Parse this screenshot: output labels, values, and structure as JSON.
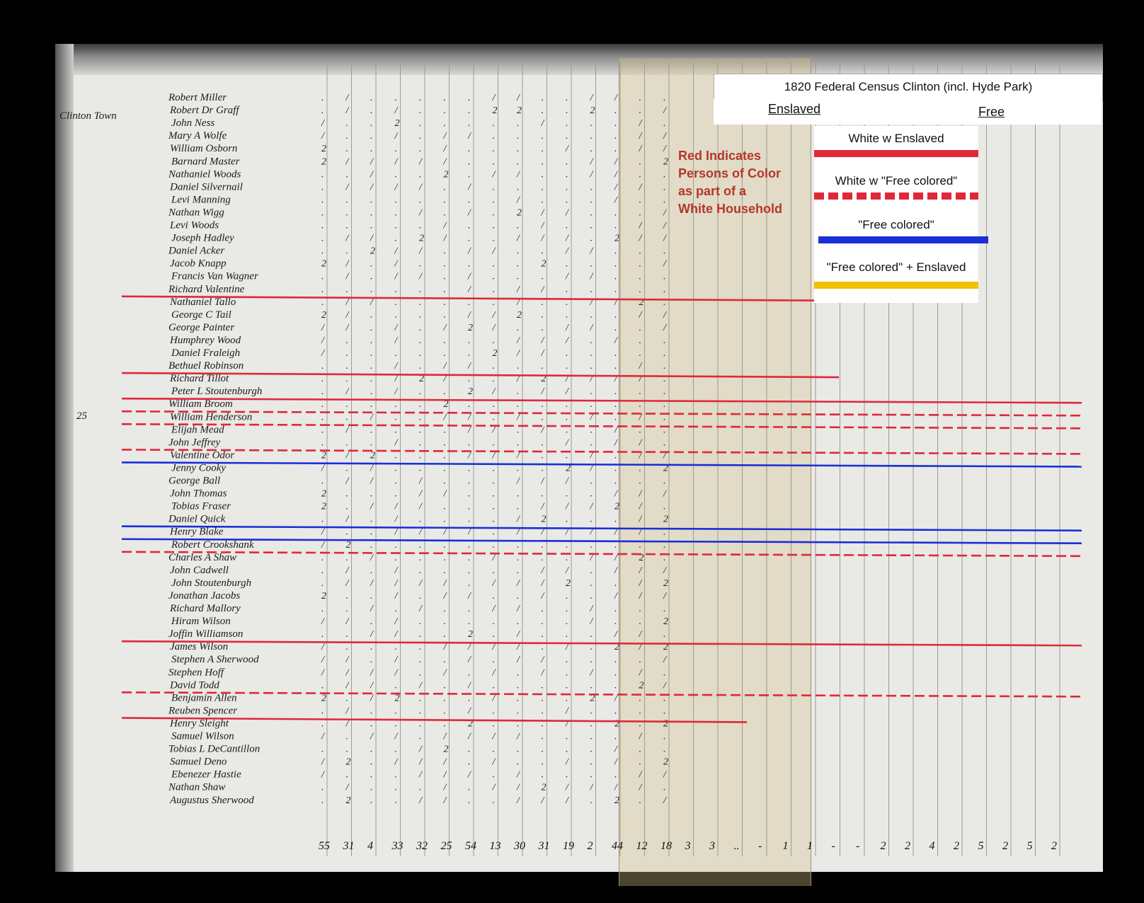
{
  "header": {
    "title": "1820 Federal Census Clinton (incl. Hyde Park)",
    "enslaved_label": "Enslaved",
    "free_label": "Free"
  },
  "red_note": "Red Indicates\nPersons of Color\nas part of a\nWhite Household",
  "legend": {
    "items": [
      {
        "label": "White w Enslaved",
        "color": "#e0283a",
        "style": "solid"
      },
      {
        "label": "White w \"Free colored\"",
        "color": "#e0283a",
        "style": "dashed"
      },
      {
        "label": "\"Free colored\"",
        "color": "#1a2ed6",
        "style": "solid"
      },
      {
        "label": "\"Free colored\" + Enslaved",
        "color": "#f5c000",
        "style": "solid"
      }
    ]
  },
  "page_number": "25",
  "town_label": "Clinton Town",
  "names": [
    "Robert Miller",
    "Robert Dr Graff",
    "John Ness",
    "Mary A Wolfe",
    "William Osborn",
    "Barnard Master",
    "Nathaniel Woods",
    "Daniel Silvernail",
    "Levi Manning",
    "Nathan Wigg",
    "Levi Woods",
    "Joseph Hadley",
    "Daniel Acker",
    "Jacob Knapp",
    "Francis Van Wagner",
    "Richard Valentine",
    "Nathaniel Tallo",
    "George C Tail",
    "George Painter",
    "Humphrey Wood",
    "Daniel Fraleigh",
    "Bethuel Robinson",
    "Richard Tillot",
    "Peter L Stoutenburgh",
    "William Broom",
    "William Henderson",
    "Elijah Mead",
    "John Jeffrey",
    "Valentine Odor",
    "Jenny Cooky",
    "George Ball",
    "John Thomas",
    "Tobias Fraser",
    "Daniel Quick",
    "Henry Blake",
    "Robert Crookshank",
    "Charles A Shaw",
    "John Cadwell",
    "John Stoutenburgh",
    "Jonathan Jacobs",
    "Richard Mallory",
    "Hiram Wilson",
    "Joffin Williamson",
    "James Wilson",
    "Stephen A Sherwood",
    "Stephen Hoff",
    "David Todd",
    "Benjamin Allen",
    "Reuben Spencer",
    "Henry Sleight",
    "Samuel Wilson",
    "Tobias L DeCantillon",
    "Samuel Deno",
    "Ebenezer Hastie",
    "Nathan Shaw",
    "Augustus Sherwood"
  ],
  "column_totals": [
    "55",
    "31",
    "4",
    "33",
    "32",
    "25",
    "54",
    "13",
    "30",
    "31",
    "19",
    "2",
    "44",
    "12",
    "18",
    "3",
    "3",
    "..",
    "-",
    "1",
    "1",
    "-",
    "-",
    "2",
    "2",
    "4",
    "2",
    "5",
    "2",
    "5",
    "2"
  ],
  "highlight_lines": [
    {
      "row": 16,
      "color": "#e0283a",
      "style": "solid",
      "end": "enslaved"
    },
    {
      "row": 22,
      "color": "#e0283a",
      "style": "solid",
      "end": "enslaved"
    },
    {
      "row": 24,
      "color": "#e0283a",
      "style": "solid",
      "end": "free"
    },
    {
      "row": 25,
      "color": "#e0283a",
      "style": "dashed",
      "end": "free"
    },
    {
      "row": 26,
      "color": "#e0283a",
      "style": "dashed",
      "end": "free"
    },
    {
      "row": 28,
      "color": "#e0283a",
      "style": "dashed",
      "end": "free"
    },
    {
      "row": 29,
      "color": "#1a2ed6",
      "style": "solid",
      "end": "free"
    },
    {
      "row": 34,
      "color": "#1a2ed6",
      "style": "solid",
      "end": "free"
    },
    {
      "row": 35,
      "color": "#1a2ed6",
      "style": "solid",
      "end": "free"
    },
    {
      "row": 36,
      "color": "#e0283a",
      "style": "dashed",
      "end": "free"
    },
    {
      "row": 43,
      "color": "#e0283a",
      "style": "solid",
      "end": "free"
    },
    {
      "row": 47,
      "color": "#e0283a",
      "style": "dashed",
      "end": "free"
    },
    {
      "row": 49,
      "color": "#e0283a",
      "style": "solid",
      "end": "mid"
    }
  ]
}
